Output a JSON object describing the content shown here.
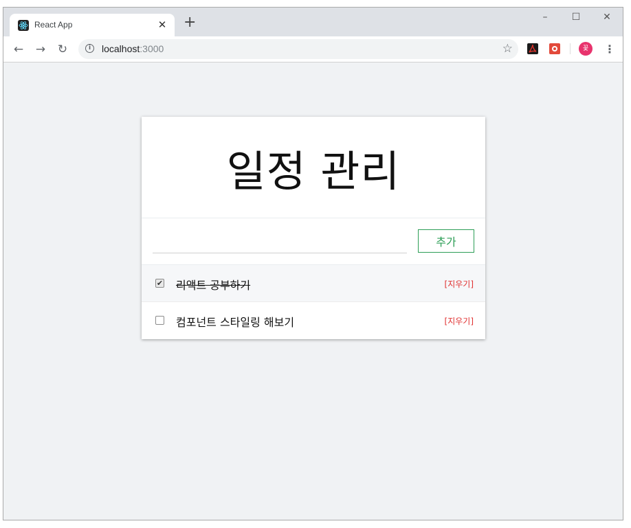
{
  "browser": {
    "tab_title": "React App",
    "new_tab_symbol": "+",
    "address_host": "localhost",
    "address_port": ":3000",
    "profile_initial": "꽃"
  },
  "app": {
    "heading": "일정 관리",
    "input_value": "",
    "add_button": "추가",
    "todos": [
      {
        "text": "리액트 공부하기",
        "done": true,
        "remove_label": "[지우기]"
      },
      {
        "text": "컴포넌트 스타일링 해보기",
        "done": false,
        "remove_label": "[지우기]"
      }
    ]
  },
  "colors": {
    "accent_green": "#2b9d55",
    "remove_red": "#e03131",
    "page_bg": "#f0f2f4"
  },
  "icons": [
    "react-logo-icon",
    "close-icon",
    "back-arrow-icon",
    "forward-arrow-icon",
    "reload-icon",
    "info-icon",
    "star-icon",
    "pdf-extension-icon",
    "extension-icon",
    "profile-avatar",
    "menu-icon",
    "checkbox-icon"
  ]
}
